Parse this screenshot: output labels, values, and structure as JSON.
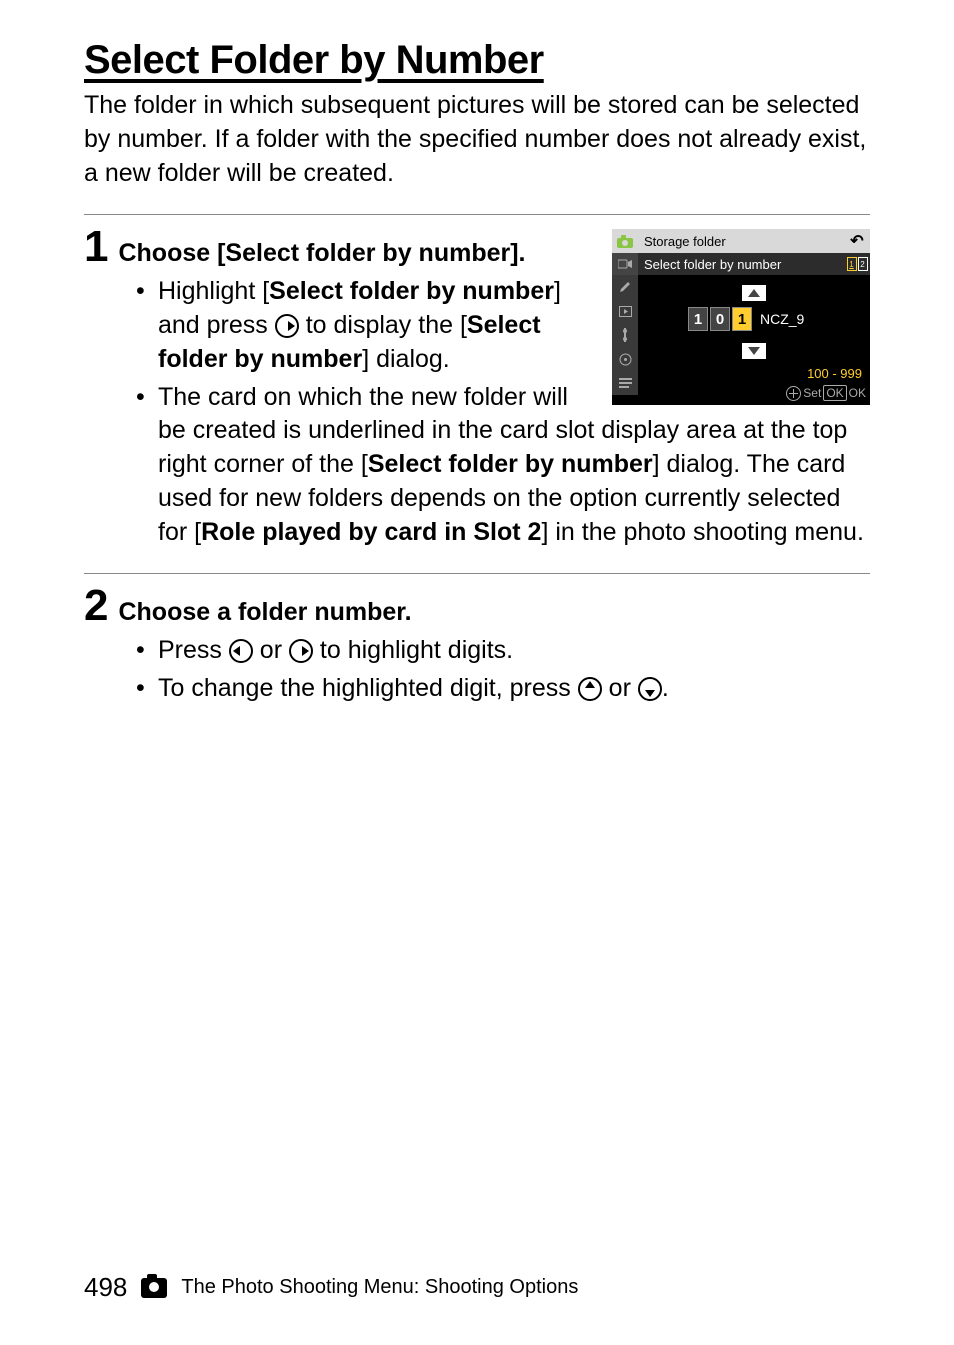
{
  "title": "Select Folder by Number",
  "intro": "The folder in which subsequent pictures will be stored can be selected by number. If a folder with the specified number does not already exist, a new folder will be created.",
  "step1": {
    "number": "1",
    "title": "Choose [Select folder by number].",
    "bullets": {
      "b1_pre": "Highlight [",
      "b1_bold1": "Select folder by number",
      "b1_mid1": "] and press ",
      "b1_mid2": " to display the [",
      "b1_bold2": "Select folder by number",
      "b1_post": "] dialog.",
      "b2_pre": "The card on which the new folder will be created is underlined in the card slot display area at the top right corner of the [",
      "b2_bold1": "Select folder by number",
      "b2_mid": "] dialog. The card used for new folders depends on the option currently selected for [",
      "b2_bold2": "Role played by card in Slot 2",
      "b2_post": "] in the photo shooting menu."
    }
  },
  "step2": {
    "number": "2",
    "title": "Choose a folder number.",
    "bullets": {
      "b1_pre": "Press ",
      "b1_mid": " or ",
      "b1_post": " to highlight digits.",
      "b2_pre": "To change the highlighted digit, press ",
      "b2_mid": " or ",
      "b2_post": "."
    }
  },
  "camera_screen": {
    "header": "Storage folder",
    "back_glyph": "↶",
    "sub": "Select folder by number",
    "card1": "1",
    "card2": "2",
    "digits": [
      "1",
      "0",
      "1"
    ],
    "suffix": "NCZ_9",
    "range": "100 - 999",
    "set_label": "Set",
    "ok_label": "OK",
    "ok_suffix": "OK"
  },
  "footer": {
    "page": "498",
    "section": "The Photo Shooting Menu: Shooting Options"
  }
}
